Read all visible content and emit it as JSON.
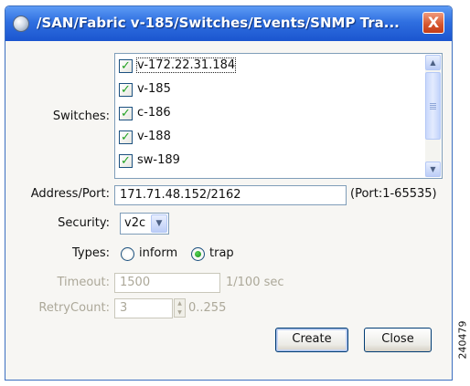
{
  "window": {
    "title": "/SAN/Fabric v-185/Switches/Events/SNMP Tra...",
    "close_label": "X"
  },
  "switches": {
    "label": "Switches:",
    "items": [
      {
        "label": "v-172.22.31.184",
        "checked": true
      },
      {
        "label": "v-185",
        "checked": true
      },
      {
        "label": "c-186",
        "checked": true
      },
      {
        "label": "v-188",
        "checked": true
      },
      {
        "label": "sw-189",
        "checked": true
      }
    ],
    "check_glyph": "✓"
  },
  "address": {
    "label": "Address/Port:",
    "value": "171.71.48.152/2162",
    "hint": "(Port:1-65535)"
  },
  "security": {
    "label": "Security:",
    "value": "v2c"
  },
  "types": {
    "label": "Types:",
    "options": [
      {
        "label": "inform",
        "selected": false
      },
      {
        "label": "trap",
        "selected": true
      }
    ]
  },
  "timeout": {
    "label": "Timeout:",
    "value": "1500",
    "unit": "1/100 sec"
  },
  "retry": {
    "label": "RetryCount:",
    "value": "3",
    "range": "0..255"
  },
  "buttons": {
    "create": "Create",
    "close": "Close"
  },
  "watermark": "240479"
}
